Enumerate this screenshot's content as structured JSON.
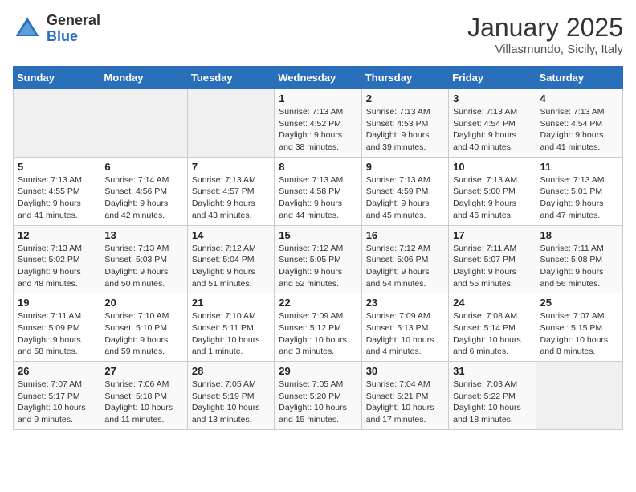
{
  "header": {
    "logo_line1": "General",
    "logo_line2": "Blue",
    "month": "January 2025",
    "location": "Villasmundo, Sicily, Italy"
  },
  "weekdays": [
    "Sunday",
    "Monday",
    "Tuesday",
    "Wednesday",
    "Thursday",
    "Friday",
    "Saturday"
  ],
  "weeks": [
    [
      {
        "day": "",
        "info": ""
      },
      {
        "day": "",
        "info": ""
      },
      {
        "day": "",
        "info": ""
      },
      {
        "day": "1",
        "info": "Sunrise: 7:13 AM\nSunset: 4:52 PM\nDaylight: 9 hours and 38 minutes."
      },
      {
        "day": "2",
        "info": "Sunrise: 7:13 AM\nSunset: 4:53 PM\nDaylight: 9 hours and 39 minutes."
      },
      {
        "day": "3",
        "info": "Sunrise: 7:13 AM\nSunset: 4:54 PM\nDaylight: 9 hours and 40 minutes."
      },
      {
        "day": "4",
        "info": "Sunrise: 7:13 AM\nSunset: 4:54 PM\nDaylight: 9 hours and 41 minutes."
      }
    ],
    [
      {
        "day": "5",
        "info": "Sunrise: 7:13 AM\nSunset: 4:55 PM\nDaylight: 9 hours and 41 minutes."
      },
      {
        "day": "6",
        "info": "Sunrise: 7:14 AM\nSunset: 4:56 PM\nDaylight: 9 hours and 42 minutes."
      },
      {
        "day": "7",
        "info": "Sunrise: 7:13 AM\nSunset: 4:57 PM\nDaylight: 9 hours and 43 minutes."
      },
      {
        "day": "8",
        "info": "Sunrise: 7:13 AM\nSunset: 4:58 PM\nDaylight: 9 hours and 44 minutes."
      },
      {
        "day": "9",
        "info": "Sunrise: 7:13 AM\nSunset: 4:59 PM\nDaylight: 9 hours and 45 minutes."
      },
      {
        "day": "10",
        "info": "Sunrise: 7:13 AM\nSunset: 5:00 PM\nDaylight: 9 hours and 46 minutes."
      },
      {
        "day": "11",
        "info": "Sunrise: 7:13 AM\nSunset: 5:01 PM\nDaylight: 9 hours and 47 minutes."
      }
    ],
    [
      {
        "day": "12",
        "info": "Sunrise: 7:13 AM\nSunset: 5:02 PM\nDaylight: 9 hours and 48 minutes."
      },
      {
        "day": "13",
        "info": "Sunrise: 7:13 AM\nSunset: 5:03 PM\nDaylight: 9 hours and 50 minutes."
      },
      {
        "day": "14",
        "info": "Sunrise: 7:12 AM\nSunset: 5:04 PM\nDaylight: 9 hours and 51 minutes."
      },
      {
        "day": "15",
        "info": "Sunrise: 7:12 AM\nSunset: 5:05 PM\nDaylight: 9 hours and 52 minutes."
      },
      {
        "day": "16",
        "info": "Sunrise: 7:12 AM\nSunset: 5:06 PM\nDaylight: 9 hours and 54 minutes."
      },
      {
        "day": "17",
        "info": "Sunrise: 7:11 AM\nSunset: 5:07 PM\nDaylight: 9 hours and 55 minutes."
      },
      {
        "day": "18",
        "info": "Sunrise: 7:11 AM\nSunset: 5:08 PM\nDaylight: 9 hours and 56 minutes."
      }
    ],
    [
      {
        "day": "19",
        "info": "Sunrise: 7:11 AM\nSunset: 5:09 PM\nDaylight: 9 hours and 58 minutes."
      },
      {
        "day": "20",
        "info": "Sunrise: 7:10 AM\nSunset: 5:10 PM\nDaylight: 9 hours and 59 minutes."
      },
      {
        "day": "21",
        "info": "Sunrise: 7:10 AM\nSunset: 5:11 PM\nDaylight: 10 hours and 1 minute."
      },
      {
        "day": "22",
        "info": "Sunrise: 7:09 AM\nSunset: 5:12 PM\nDaylight: 10 hours and 3 minutes."
      },
      {
        "day": "23",
        "info": "Sunrise: 7:09 AM\nSunset: 5:13 PM\nDaylight: 10 hours and 4 minutes."
      },
      {
        "day": "24",
        "info": "Sunrise: 7:08 AM\nSunset: 5:14 PM\nDaylight: 10 hours and 6 minutes."
      },
      {
        "day": "25",
        "info": "Sunrise: 7:07 AM\nSunset: 5:15 PM\nDaylight: 10 hours and 8 minutes."
      }
    ],
    [
      {
        "day": "26",
        "info": "Sunrise: 7:07 AM\nSunset: 5:17 PM\nDaylight: 10 hours and 9 minutes."
      },
      {
        "day": "27",
        "info": "Sunrise: 7:06 AM\nSunset: 5:18 PM\nDaylight: 10 hours and 11 minutes."
      },
      {
        "day": "28",
        "info": "Sunrise: 7:05 AM\nSunset: 5:19 PM\nDaylight: 10 hours and 13 minutes."
      },
      {
        "day": "29",
        "info": "Sunrise: 7:05 AM\nSunset: 5:20 PM\nDaylight: 10 hours and 15 minutes."
      },
      {
        "day": "30",
        "info": "Sunrise: 7:04 AM\nSunset: 5:21 PM\nDaylight: 10 hours and 17 minutes."
      },
      {
        "day": "31",
        "info": "Sunrise: 7:03 AM\nSunset: 5:22 PM\nDaylight: 10 hours and 18 minutes."
      },
      {
        "day": "",
        "info": ""
      }
    ]
  ]
}
